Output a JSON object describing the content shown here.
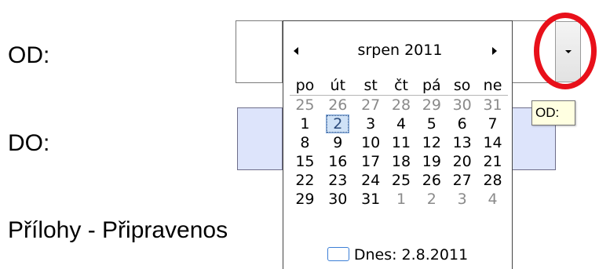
{
  "form": {
    "od_label": "OD:",
    "do_label": "DO:",
    "prilohy_label": "Přílohy - Připravenos",
    "tooltip": "OD:"
  },
  "calendar": {
    "title": "srpen 2011",
    "weekdays": [
      "po",
      "út",
      "st",
      "čt",
      "pá",
      "so",
      "ne"
    ],
    "weeks": [
      [
        "25",
        "26",
        "27",
        "28",
        "29",
        "30",
        "31"
      ],
      [
        "1",
        "2",
        "3",
        "4",
        "5",
        "6",
        "7"
      ],
      [
        "8",
        "9",
        "10",
        "11",
        "12",
        "13",
        "14"
      ],
      [
        "15",
        "16",
        "17",
        "18",
        "19",
        "20",
        "21"
      ],
      [
        "22",
        "23",
        "24",
        "25",
        "26",
        "27",
        "28"
      ],
      [
        "29",
        "30",
        "31",
        "1",
        "2",
        "3",
        "4"
      ]
    ],
    "selected_day": "2",
    "today_label": "Dnes: 2.8.2011"
  },
  "colors": {
    "highlight_circle": "#e8101a",
    "do_field_bg": "#dde4fb",
    "tooltip_bg": "#ffffe1",
    "selected_day_bg": "#cfe2f7",
    "muted_day": "#8a8a8a"
  },
  "icons": {
    "dropdown": "chevron-down-icon",
    "prev_month": "triangle-left-icon",
    "next_month": "triangle-right-icon",
    "today_marker": "today-box-icon"
  }
}
